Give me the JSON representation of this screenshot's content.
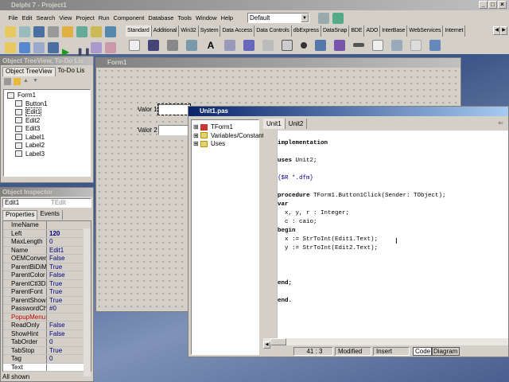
{
  "app": {
    "title": "Delphi 7 - Project1",
    "window_controls": [
      "_",
      "□",
      "×"
    ]
  },
  "menu": [
    "File",
    "Edit",
    "Search",
    "View",
    "Project",
    "Run",
    "Component",
    "Database",
    "Tools",
    "Window",
    "Help"
  ],
  "desktop_combo": {
    "value": "Default"
  },
  "palette": {
    "tabs": [
      "Standard",
      "Additional",
      "Win32",
      "System",
      "Data Access",
      "Data Controls",
      "dbExpress",
      "DataSnap",
      "BDE",
      "ADO",
      "InterBase",
      "WebServices",
      "Internet"
    ],
    "active": "Standard"
  },
  "treeview": {
    "title": "Object TreeView, To-Do Lis",
    "tabs": [
      "Object TreeView",
      "To-Do Lis"
    ],
    "items": [
      "Form1",
      "Button1",
      "Edit1",
      "Edit2",
      "Edit3",
      "Label1",
      "Label2",
      "Label3"
    ],
    "selected": "Edit1"
  },
  "inspector": {
    "title": "Object Inspector",
    "object": "Edit1",
    "object_type": "TEdit",
    "tabs": [
      "Properties",
      "Events"
    ],
    "props": [
      {
        "k": "ImeName",
        "v": ""
      },
      {
        "k": "Left",
        "v": "120",
        "bold": true
      },
      {
        "k": "MaxLength",
        "v": "0"
      },
      {
        "k": "Name",
        "v": "Edit1"
      },
      {
        "k": "OEMConvert",
        "v": "False"
      },
      {
        "k": "ParentBiDiMod",
        "v": "True"
      },
      {
        "k": "ParentColor",
        "v": "False"
      },
      {
        "k": "ParentCtl3D",
        "v": "True"
      },
      {
        "k": "ParentFont",
        "v": "True"
      },
      {
        "k": "ParentShowHir",
        "v": "True"
      },
      {
        "k": "PasswordChar",
        "v": "#0"
      },
      {
        "k": "PopupMenu",
        "v": "",
        "red": true
      },
      {
        "k": "ReadOnly",
        "v": "False"
      },
      {
        "k": "ShowHint",
        "v": "False"
      },
      {
        "k": "TabOrder",
        "v": "0"
      },
      {
        "k": "TabStop",
        "v": "True"
      },
      {
        "k": "Tag",
        "v": "0"
      },
      {
        "k": "Text",
        "v": ""
      }
    ],
    "status": "All shown"
  },
  "form": {
    "title": "Form1",
    "label1": "Valor 1",
    "label2": "Valor 2"
  },
  "editor": {
    "title": "Unit1.pas",
    "tabs": [
      "Unit1",
      "Unit2"
    ],
    "active_tab": "Unit1",
    "explorer": [
      "TForm1",
      "Variables/Constants",
      "Uses"
    ],
    "code": [
      {
        "t": "implementation",
        "c": "kw"
      },
      {
        "t": "",
        "c": ""
      },
      {
        "t": "uses Unit2;",
        "c": "uses"
      },
      {
        "t": "",
        "c": ""
      },
      {
        "t": "{$R *.dfm}",
        "c": "cm"
      },
      {
        "t": "",
        "c": ""
      },
      {
        "t": "procedure TForm1.Button1Click(Sender: TObject);",
        "c": "proc"
      },
      {
        "t": "var",
        "c": "kw"
      },
      {
        "t": "  x, y, r : Integer;",
        "c": ""
      },
      {
        "t": "  c : caio;",
        "c": ""
      },
      {
        "t": "begin",
        "c": "kw"
      },
      {
        "t": "  x := StrToInt(Edit1.Text);",
        "c": ""
      },
      {
        "t": "  y := StrToInt(Edit2.Text);",
        "c": ""
      },
      {
        "t": "",
        "c": ""
      },
      {
        "t": "",
        "c": ""
      },
      {
        "t": "",
        "c": ""
      },
      {
        "t": "end;",
        "c": "kw"
      },
      {
        "t": "",
        "c": ""
      },
      {
        "t": "end.",
        "c": "kw"
      }
    ],
    "status": {
      "position": "41 : 3",
      "modified": "Modified",
      "mode": "Insert"
    },
    "bottom_tabs": [
      "Code",
      "Diagram"
    ]
  }
}
